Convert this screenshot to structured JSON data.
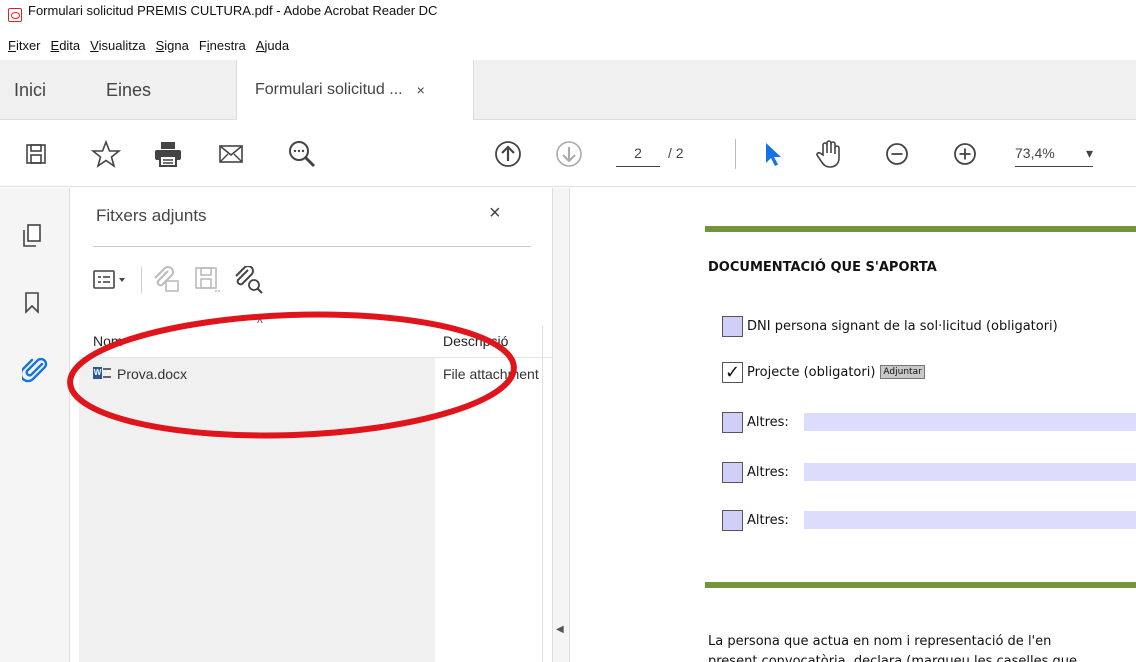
{
  "window": {
    "title": "Formulari solicitud PREMIS CULTURA.pdf - Adobe Acrobat Reader DC"
  },
  "menu": {
    "items": [
      "Fitxer",
      "Edita",
      "Visualitza",
      "Signa",
      "Finestra",
      "Ajuda"
    ],
    "mnemonics": [
      "F",
      "E",
      "V",
      "S",
      "i",
      "A"
    ]
  },
  "tabs": {
    "home": "Inici",
    "tools": "Eines",
    "document": "Formulari solicitud ...",
    "close": "×"
  },
  "toolbar": {
    "current_page": "2",
    "total_pages": "/ 2",
    "zoom": "73,4%",
    "zoom_arrow": "▾"
  },
  "attachments_panel": {
    "title": "Fitxers adjunts",
    "close": "×",
    "columns": {
      "name": "Nom",
      "description": "Descripció",
      "sort_indicator": "^"
    },
    "files": [
      {
        "name": "Prova.docx",
        "description": "File attachment"
      }
    ]
  },
  "document": {
    "heading": "DOCUMENTACIÓ QUE S'APORTA",
    "checklist": [
      {
        "label": "DNI persona signant de la sol·licitud (obligatori)",
        "checked": false
      },
      {
        "label": "Projecte (obligatori)",
        "checked": true,
        "button": "Adjuntar"
      },
      {
        "label": "Altres:",
        "checked": false
      },
      {
        "label": "Altres:",
        "checked": false
      },
      {
        "label": "Altres:",
        "checked": false
      }
    ],
    "check_mark": "✓",
    "paragraph_line1": "La persona que actua en nom i representació de l'en",
    "paragraph_line2": "present convocatòria, declara (marqueu les caselles que"
  },
  "annotation": {
    "color": "#e0151b"
  }
}
